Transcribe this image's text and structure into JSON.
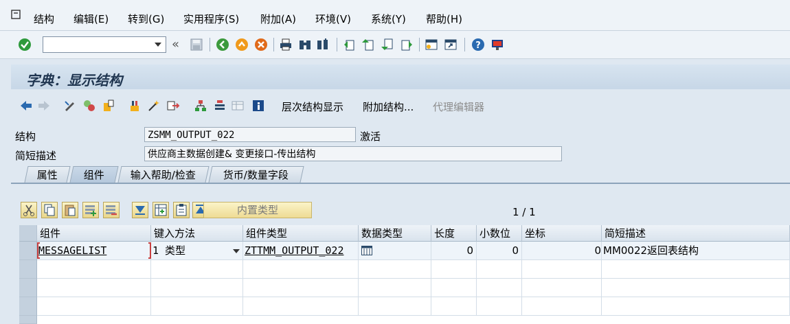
{
  "menu": {
    "items": [
      "结构",
      "编辑(E)",
      "转到(G)",
      "实用程序(S)",
      "附加(A)",
      "环境(V)",
      "系统(Y)",
      "帮助(H)"
    ]
  },
  "toolbar": {
    "command_field_value": "",
    "back_label": "«"
  },
  "page_title": "字典：显示结构",
  "app_toolbar": {
    "hierarchy_button": "层次结构显示",
    "append_button": "附加结构...",
    "proxy_editor_button": "代理编辑器"
  },
  "header": {
    "structure_label": "结构",
    "structure_value": "ZSMM_OUTPUT_022",
    "status": "激活",
    "short_desc_label": "简短描述",
    "short_desc_value": "供应商主数据创建& 变更接口-传出结构"
  },
  "tabs": [
    {
      "label": "属性",
      "active": false
    },
    {
      "label": "组件",
      "active": true
    },
    {
      "label": "输入帮助/检查",
      "active": false
    },
    {
      "label": "货币/数量字段",
      "active": false
    }
  ],
  "grid_toolbar": {
    "builtin_type_button": "内置类型",
    "pager": "1  /  1"
  },
  "table": {
    "columns": [
      "组件",
      "键入方法",
      "组件类型",
      "数据类型",
      "长度",
      "小数位",
      "坐标",
      "简短描述"
    ],
    "rows": [
      {
        "component": "MESSAGELIST",
        "typing_method": "1 类型",
        "component_type": "ZTTMM_OUTPUT_022",
        "data_type_icon": "table-type-icon",
        "length": "0",
        "decimals": "0",
        "coordinate": "0",
        "short_desc": "MM0022返回表结构"
      }
    ]
  },
  "colors": {
    "accent_green": "#2e9a3c",
    "title_color": "#1f3550",
    "grid_button_yellow": "#eedb94"
  }
}
